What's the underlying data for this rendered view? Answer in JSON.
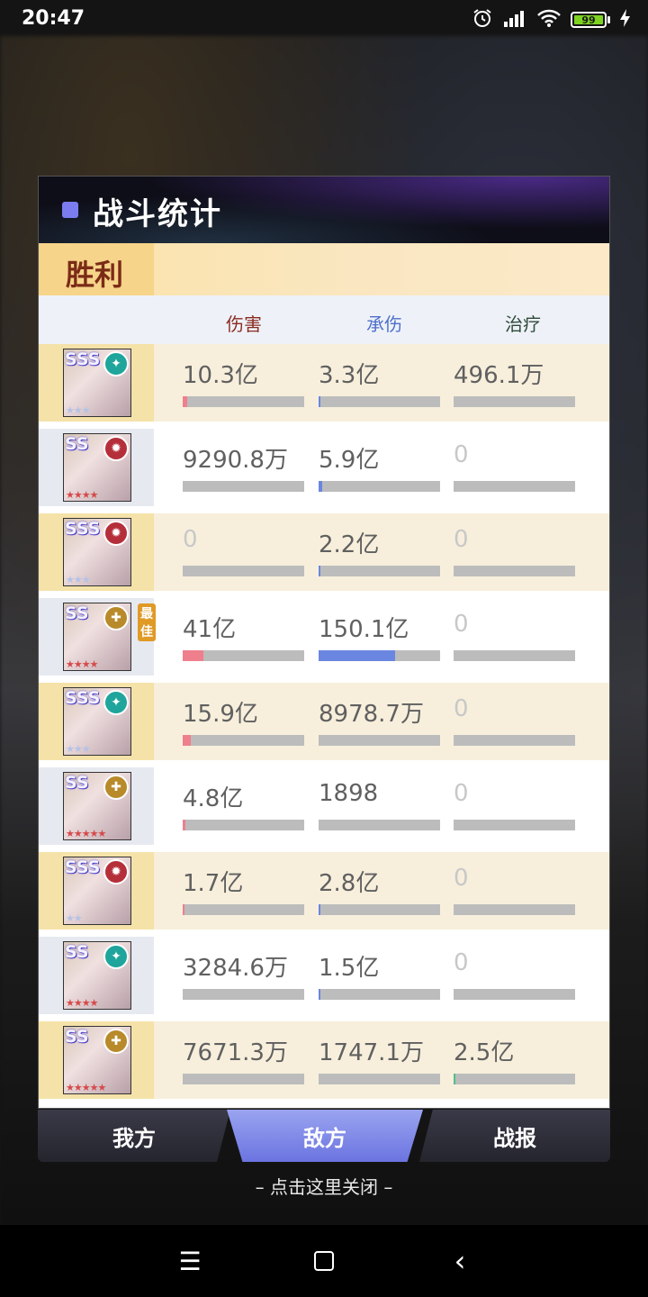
{
  "status_bar": {
    "time": "20:47",
    "battery": "99",
    "icons": [
      "alarm-icon",
      "signal-icon",
      "wifi-icon",
      "battery-icon",
      "charging-icon"
    ]
  },
  "dialog": {
    "title": "战斗统计",
    "result": "胜利",
    "columns": {
      "damage": "伤害",
      "taken": "承伤",
      "heal": "治疗"
    },
    "best_label": "最佳",
    "rows": [
      {
        "rank": "SSS",
        "element": "cyan",
        "star_color": "blue",
        "stars": "★★★",
        "damage": "10.3亿",
        "taken": "3.3亿",
        "heal": "496.1万",
        "damage_frac": 0.04,
        "taken_frac": 0.01,
        "heal_frac": 0.0
      },
      {
        "rank": "SS",
        "element": "red",
        "star_color": "red",
        "stars": "★★★★",
        "damage": "9290.8万",
        "taken": "5.9亿",
        "heal": "0",
        "damage_frac": 0.0,
        "taken_frac": 0.03,
        "heal_frac": 0.0
      },
      {
        "rank": "SSS",
        "element": "red",
        "star_color": "blue",
        "stars": "★★★",
        "damage": "0",
        "taken": "2.2亿",
        "heal": "0",
        "damage_frac": 0.0,
        "taken_frac": 0.01,
        "heal_frac": 0.0
      },
      {
        "rank": "SS",
        "element": "gold",
        "star_color": "red",
        "stars": "★★★★",
        "damage": "41亿",
        "taken": "150.1亿",
        "heal": "0",
        "damage_frac": 0.17,
        "taken_frac": 0.63,
        "heal_frac": 0.0
      },
      {
        "rank": "SSS",
        "element": "cyan",
        "star_color": "blue",
        "stars": "★★★",
        "damage": "15.9亿",
        "taken": "8978.7万",
        "heal": "0",
        "damage_frac": 0.07,
        "taken_frac": 0.0,
        "heal_frac": 0.0
      },
      {
        "rank": "SS",
        "element": "gold",
        "star_color": "red",
        "stars": "★★★★★",
        "damage": "4.8亿",
        "taken": "1898",
        "heal": "0",
        "damage_frac": 0.02,
        "taken_frac": 0.0,
        "heal_frac": 0.0
      },
      {
        "rank": "SSS",
        "element": "red",
        "star_color": "blue",
        "stars": "★★",
        "damage": "1.7亿",
        "taken": "2.8亿",
        "heal": "0",
        "damage_frac": 0.01,
        "taken_frac": 0.01,
        "heal_frac": 0.0
      },
      {
        "rank": "SS",
        "element": "cyan",
        "star_color": "red",
        "stars": "★★★★",
        "damage": "3284.6万",
        "taken": "1.5亿",
        "heal": "0",
        "damage_frac": 0.0,
        "taken_frac": 0.01,
        "heal_frac": 0.0
      },
      {
        "rank": "SS",
        "element": "gold",
        "star_color": "red",
        "stars": "★★★★★",
        "damage": "7671.3万",
        "taken": "1747.1万",
        "heal": "2.5亿",
        "damage_frac": 0.0,
        "taken_frac": 0.0,
        "heal_frac": 0.01
      }
    ],
    "best_row_index": 3
  },
  "tabs": {
    "mine": "我方",
    "enemy": "敌方",
    "report": "战报"
  },
  "close_hint": "– 点击这里关闭 –",
  "navbar": {
    "menu": "☰",
    "back": "‹"
  }
}
